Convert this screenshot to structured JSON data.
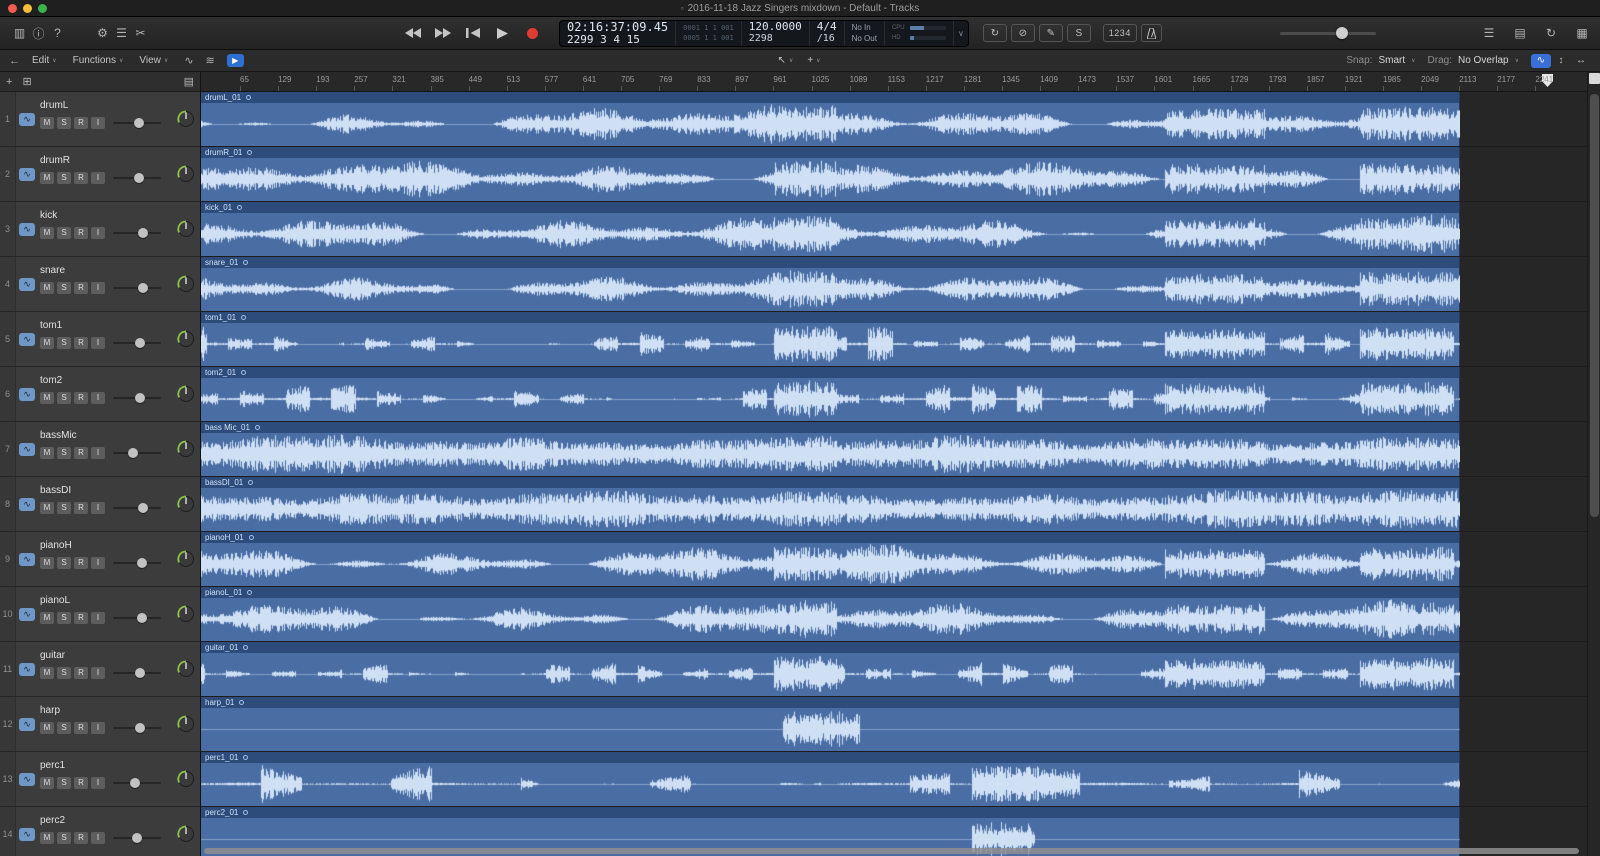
{
  "titlebar": {
    "title": "2016-11-18 Jazz Singers mixdown - Default - Tracks"
  },
  "colors": {
    "region": "#4a6da4",
    "region_header": "#2d4c7c",
    "waveform": "#cfe0f5",
    "accent_blue": "#3a6fd8",
    "record_red": "#e03c31",
    "knob_green": "#8bc34a"
  },
  "icons": {
    "doc": "▫",
    "library": "▥",
    "inspector": "ⓘ",
    "help": "?",
    "smart_controls": "⚙",
    "mixer": "☰",
    "editors": "✂",
    "cycle": "↻",
    "punch": "⊘",
    "pencil": "✎",
    "low_latency": "S",
    "list_editors": "☰",
    "note_pads": "▤",
    "loop_browser": "↻",
    "media_browser": "▦",
    "chev": "∨",
    "plus": "+",
    "group": "⊞",
    "config": "▤",
    "pointer": "↖",
    "crosshair": "+",
    "back": "←",
    "automation": "∿",
    "flex": "≋",
    "catch": "▶",
    "zoom_wave": "∿",
    "zoom_v": "↕",
    "zoom_h": "↔"
  },
  "lcd": {
    "time": "02:16:37:09.45",
    "position": "2299 3 4  15",
    "aux_top": "0001 1 1 001",
    "aux_bottom": "0005 1 1 001",
    "tempo": "120.0000",
    "tempo_sub": "2298",
    "sig": "4/4",
    "sig_sub": "/16",
    "input": "No In",
    "output": "No Out",
    "cpu_label": "CPU",
    "hd_label": "HD"
  },
  "controlbar": {
    "count_in": "1234"
  },
  "toolbar": {
    "menus": [
      {
        "label": "Edit"
      },
      {
        "label": "Functions"
      },
      {
        "label": "View"
      }
    ],
    "snap": {
      "label": "Snap:",
      "value": "Smart"
    },
    "drag": {
      "label": "Drag:",
      "value": "No Overlap"
    }
  },
  "ruler": {
    "ticks": [
      65,
      129,
      193,
      257,
      321,
      385,
      449,
      513,
      577,
      641,
      705,
      769,
      833,
      897,
      961,
      1025,
      1089,
      1153,
      1217,
      1281,
      1345,
      1409,
      1473,
      1537,
      1601,
      1665,
      1729,
      1793,
      1857,
      1921,
      1985,
      2049,
      2113,
      2177,
      2241
    ]
  },
  "track_buttons": [
    "M",
    "S",
    "R",
    "I"
  ],
  "tracks": [
    {
      "num": 1,
      "name": "drumL",
      "region": "drumL_01",
      "wave": "dense",
      "seed": 11,
      "volume": 0.55
    },
    {
      "num": 2,
      "name": "drumR",
      "region": "drumR_01",
      "wave": "dense",
      "seed": 12,
      "volume": 0.55
    },
    {
      "num": 3,
      "name": "kick",
      "region": "kick_01",
      "wave": "dense",
      "seed": 13,
      "volume": 0.62
    },
    {
      "num": 4,
      "name": "snare",
      "region": "snare_01",
      "wave": "dense",
      "seed": 14,
      "volume": 0.62
    },
    {
      "num": 5,
      "name": "tom1",
      "region": "tom1_01",
      "wave": "sparse",
      "seed": 15,
      "volume": 0.57
    },
    {
      "num": 6,
      "name": "tom2",
      "region": "tom2_01",
      "wave": "sparse",
      "seed": 16,
      "volume": 0.57
    },
    {
      "num": 7,
      "name": "bassMic",
      "region": "bass Mic_01",
      "wave": "full",
      "seed": 17,
      "volume": 0.42
    },
    {
      "num": 8,
      "name": "bassDI",
      "region": "bassDI_01",
      "wave": "full",
      "seed": 18,
      "volume": 0.62
    },
    {
      "num": 9,
      "name": "pianoH",
      "region": "pianoH_01",
      "wave": "dense",
      "seed": 19,
      "volume": 0.6
    },
    {
      "num": 10,
      "name": "pianoL",
      "region": "pianoL_01",
      "wave": "dense",
      "seed": 20,
      "volume": 0.6
    },
    {
      "num": 11,
      "name": "guitar",
      "region": "guitar_01",
      "wave": "sparse",
      "seed": 21,
      "volume": 0.57
    },
    {
      "num": 12,
      "name": "harp",
      "region": "harp_01",
      "wave": "burstH",
      "seed": 22,
      "volume": 0.57
    },
    {
      "num": 13,
      "name": "perc1",
      "region": "perc1_01",
      "wave": "perc",
      "seed": 23,
      "volume": 0.45
    },
    {
      "num": 14,
      "name": "perc2",
      "region": "perc2_01",
      "wave": "burstP",
      "seed": 24,
      "volume": 0.5
    }
  ]
}
